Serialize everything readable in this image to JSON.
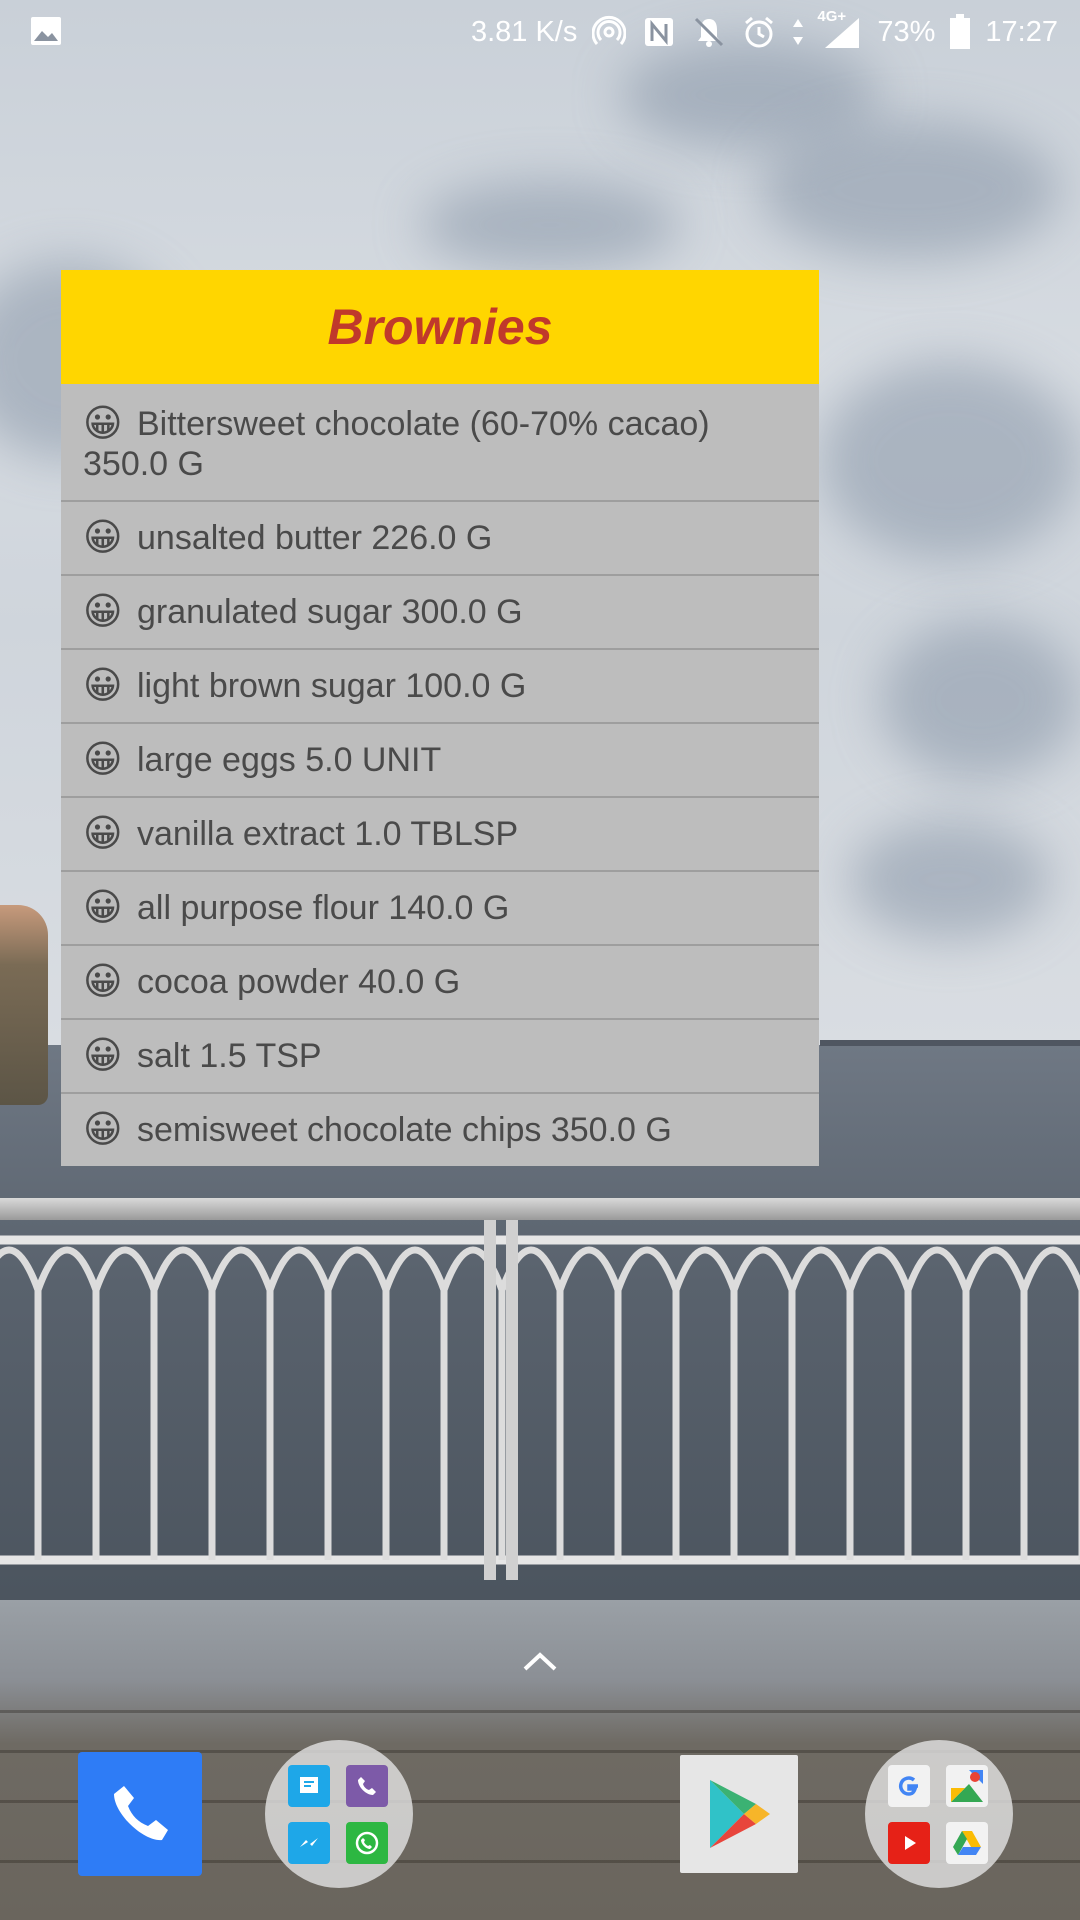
{
  "status_bar": {
    "speed": "3.81 K/s",
    "network": "4G+",
    "battery": "73%",
    "time": "17:27",
    "icons": [
      "gallery-icon",
      "hotspot-icon",
      "nfc-icon",
      "bell-off-icon",
      "alarm-icon",
      "data-arrows-icon",
      "signal-icon",
      "battery-icon"
    ]
  },
  "widget": {
    "title": "Brownies",
    "emoji": "😀",
    "ingredients": [
      "Bittersweet chocolate (60-70% cacao) 350.0 G",
      "unsalted butter 226.0 G",
      "granulated sugar 300.0 G",
      "light brown sugar 100.0 G",
      "large eggs 5.0 UNIT",
      "vanilla extract 1.0 TBLSP",
      "all purpose flour 140.0 G",
      "cocoa powder 40.0 G",
      "salt 1.5 TSP",
      "semisweet chocolate chips 350.0 G"
    ],
    "colors": {
      "header": "#ffd600",
      "title": "#c0392b",
      "body": "#bdbdbd",
      "text": "#4a4a4a"
    }
  },
  "dock": {
    "items": [
      "phone-app",
      "messaging-folder",
      "play-store-app",
      "google-folder"
    ],
    "colors": {
      "phone": "#2e7cf6"
    }
  }
}
